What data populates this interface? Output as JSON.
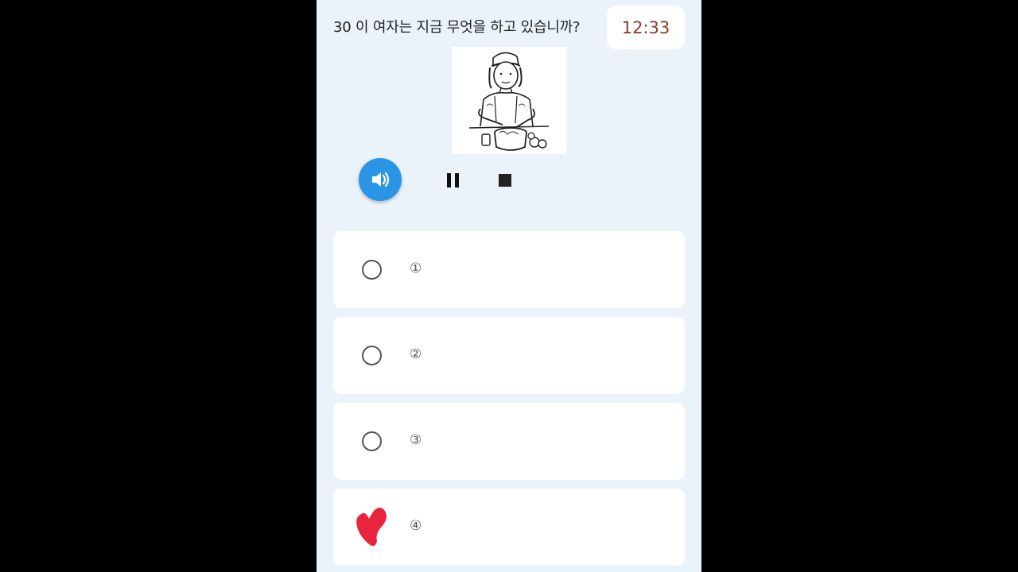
{
  "question": {
    "text": "30 이 여자는 지금 무엇을 하고 있습니까?"
  },
  "timer": {
    "value": "12:33"
  },
  "illustration": {
    "subject": "woman-cooking-illustration"
  },
  "audio_controls": {
    "play_icon": "speaker-icon",
    "pause_icon": "pause-icon",
    "stop_icon": "stop-icon",
    "accent_color": "#2a94e6"
  },
  "options": [
    {
      "label": "①",
      "selected": false
    },
    {
      "label": "②",
      "selected": false
    },
    {
      "label": "③",
      "selected": false
    },
    {
      "label": "④",
      "selected": true,
      "mark": "heart-icon",
      "mark_color": "#e8253c"
    }
  ]
}
